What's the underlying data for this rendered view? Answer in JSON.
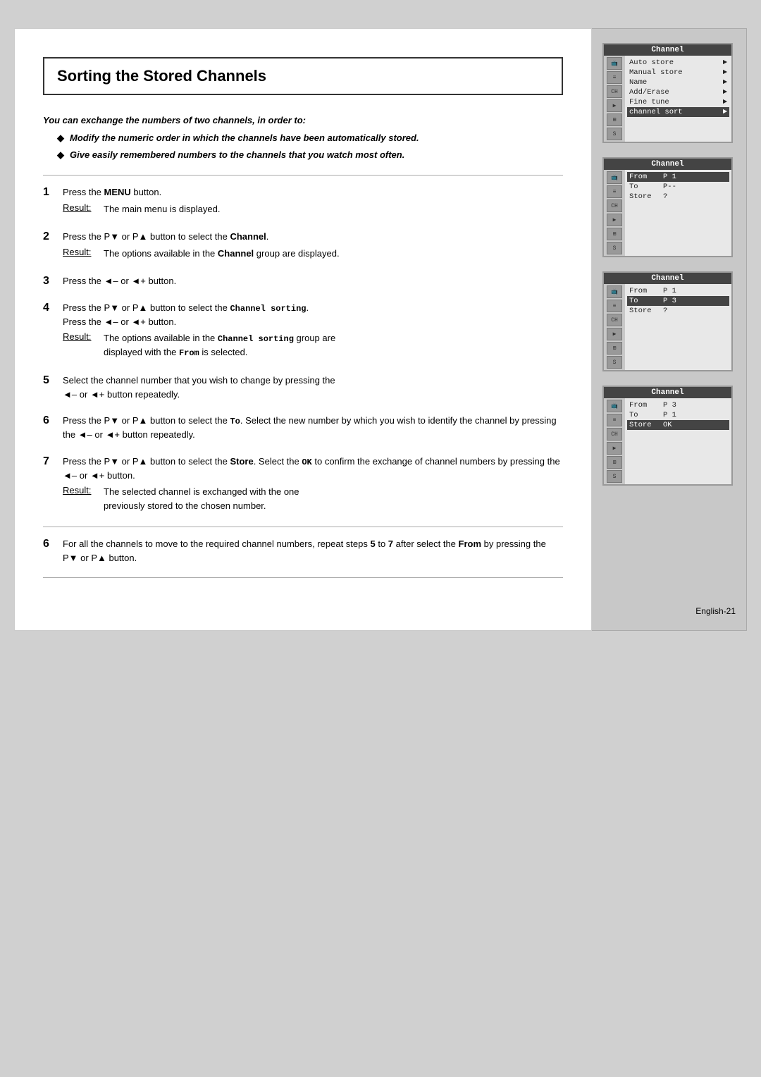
{
  "page": {
    "title": "Sorting the Stored Channels",
    "footer": "English-21"
  },
  "intro": {
    "lead": "You can exchange the numbers of two channels, in order to:",
    "bullets": [
      "Modify the numeric order in which the channels have been automatically stored.",
      "Give easily remembered numbers to the channels that you watch most often."
    ]
  },
  "steps": [
    {
      "number": "1",
      "text": "Press the MENU button.",
      "result_label": "Result:",
      "result_text": "The main menu is displayed."
    },
    {
      "number": "2",
      "text": "Press the P▼ or P▲ button to select the Channel.",
      "result_label": "Result:",
      "result_text": "The options available in the Channel group are displayed."
    },
    {
      "number": "3",
      "text": "Press the ◄– or ◄+ button."
    },
    {
      "number": "4",
      "text": "Press the P▼ or P▲ button to select the Channel sorting. Press the ◄– or ◄+ button.",
      "result_label": "Result:",
      "result_text": "The options available in the Channel sorting group are displayed with the From is selected."
    },
    {
      "number": "5",
      "text": "Select the channel number that you wish to change by pressing the ◄– or ◄+ button repeatedly."
    },
    {
      "number": "6",
      "text": "Press the P▼ or P▲ button to select the To. Select the new number by which you wish to identify the channel by pressing the ◄– or ◄+ button repeatedly."
    },
    {
      "number": "7",
      "text": "Press the P▼ or P▲ button to select the Store. Select the OK to confirm the exchange of channel numbers by pressing the ◄– or ◄+ button.",
      "result_label": "Result:",
      "result_text": "The selected channel is exchanged with the one previously stored to the chosen number."
    },
    {
      "number": "6b",
      "text": "For all the channels to move to the required channel numbers, repeat steps 5 to 7 after select the From by pressing the P▼ or P▲ button."
    }
  ],
  "screens": [
    {
      "id": "screen1",
      "title": "Channel",
      "menu_items": [
        {
          "label": "Auto store",
          "arrow": "►",
          "highlighted": false
        },
        {
          "label": "Manual store",
          "arrow": "►",
          "highlighted": false
        },
        {
          "label": "Name",
          "arrow": "►",
          "highlighted": false
        },
        {
          "label": "Add/Erase",
          "arrow": "►",
          "highlighted": false
        },
        {
          "label": "Fine tune",
          "arrow": "►",
          "highlighted": false
        },
        {
          "label": "channel sort",
          "arrow": "►",
          "highlighted": true
        }
      ]
    },
    {
      "id": "screen2",
      "title": "Channel",
      "sort_rows": [
        {
          "label": "From",
          "value": "P 1",
          "highlighted": true
        },
        {
          "label": "To",
          "value": "P--",
          "highlighted": false
        },
        {
          "label": "Store",
          "value": "?",
          "highlighted": false
        }
      ]
    },
    {
      "id": "screen3",
      "title": "Channel",
      "sort_rows": [
        {
          "label": "From",
          "value": "P 1",
          "highlighted": false
        },
        {
          "label": "To",
          "value": "P 3",
          "highlighted": true
        },
        {
          "label": "Store",
          "value": "?",
          "highlighted": false
        }
      ]
    },
    {
      "id": "screen4",
      "title": "Channel",
      "sort_rows": [
        {
          "label": "From",
          "value": "P 3",
          "highlighted": false
        },
        {
          "label": "To",
          "value": "P 1",
          "highlighted": false
        },
        {
          "label": "Store",
          "value": "OK",
          "highlighted": true
        }
      ]
    }
  ]
}
